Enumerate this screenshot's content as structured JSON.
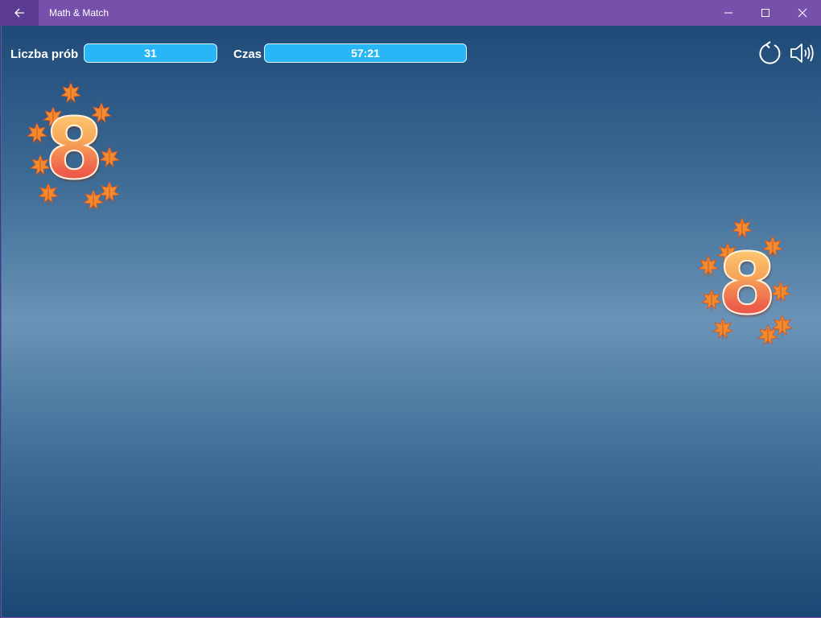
{
  "window": {
    "title": "Math & Match",
    "icons": {
      "back": "arrow-left-icon",
      "minimize": "minimize-icon",
      "maximize": "maximize-icon",
      "close": "close-icon"
    },
    "titlebar_color": "#7650ab"
  },
  "stats": {
    "attempts_label": "Liczba prób",
    "attempts_value": "31",
    "time_label": "Czas",
    "time_value": "57:21"
  },
  "controls": {
    "restart_icon": "restart-icon",
    "sound_icon": "speaker-icon"
  },
  "cards": [
    {
      "value": "8",
      "decoration": "maple-leaves"
    },
    {
      "value": "8",
      "decoration": "maple-leaves"
    }
  ],
  "colors": {
    "accent": "#29b6f6",
    "digit_top": "#ffd27a",
    "digit_bottom": "#e44a4a",
    "leaf": "#f28b2f"
  }
}
